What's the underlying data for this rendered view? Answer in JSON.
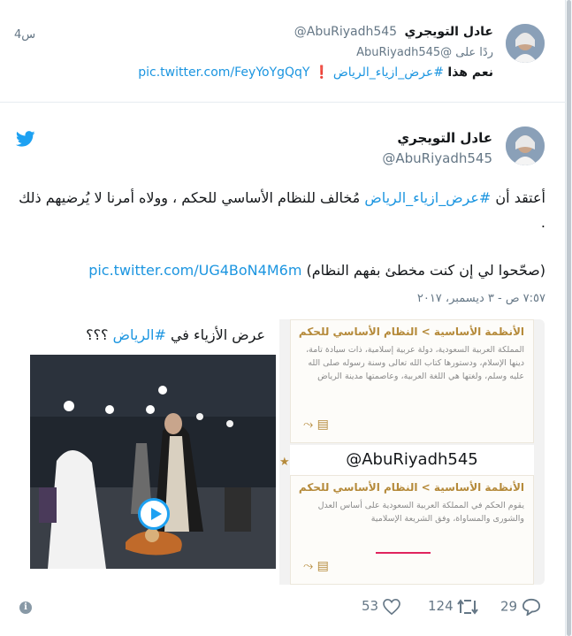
{
  "reply_tweet": {
    "name": "عادل التويجري",
    "handle": "@AbuRiyadh545",
    "time": "4س",
    "replying_prefix": "ردًا على",
    "replying_handle": "@AbuRiyadh545",
    "text_bold": "نعم هذا",
    "hashtag": "#عرض_ازياء_الرياض",
    "link": "pic.twitter.com/FeyYoYgQqY"
  },
  "main_tweet": {
    "name": "عادل التويجري",
    "handle": "@AbuRiyadh545",
    "text_before_tag": "أعتقد أن",
    "hashtag": "#عرض_ازياء_الرياض",
    "text_after_tag": "مُخالف للنظام الأساسي للحكم ، وولاه أمرنا لا يُرضيهم ذلك .",
    "correction": "(صحّحوا لي إن كنت مخطئ بفهم النظام)",
    "link": "pic.twitter.com/UG4BoN4M6m",
    "date": "٧:٥٧ ص - ٣ ديسمبر، ٢٠١٧"
  },
  "media": {
    "left_title_prefix": "عرض الأزياء في",
    "left_title_tag": "#الرياض",
    "left_title_suffix": "؟؟؟",
    "doc1_title": "الأنظمة الأساسية > النظام الأساسي للحكم",
    "doc1_body": "المملكة العربية السعودية، دولة عربية إسلامية، ذات سيادة تامة، دينها الإسلام، ودستورها كتاب الله تعالى وسنة رسوله صلى الله عليه وسلم، ولغتها هي اللغة العربية، وعاصمتها مدينة الرياض",
    "watermark": "@AbuRiyadh545",
    "doc2_title": "الأنظمة الأساسية > النظام الأساسي للحكم",
    "doc2_body": "يقوم الحكم في المملكة العربية السعودية على أساس العدل والشورى والمساواة، وفق الشريعة الإسلامية"
  },
  "actions": {
    "replies": "29",
    "retweets": "124",
    "likes": "53"
  },
  "colors": {
    "link": "#1b95e0",
    "twitter_blue": "#1da1f2",
    "muted": "#657786",
    "doc_gold": "#b58a3a"
  }
}
